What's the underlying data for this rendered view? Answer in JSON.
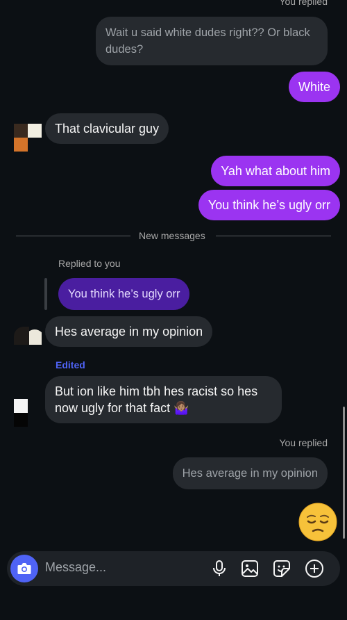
{
  "thread": {
    "top_reply_label": "You replied",
    "top_reply_text": "Wait u said white dudes right?? Or black dudes?",
    "msg_white": "White",
    "msg_clavicular": "That clavicular guy",
    "msg_yah": "Yah what about him",
    "msg_ugly": "You think he’s ugly orr",
    "divider_label": "New messages",
    "replied_to_you": "Replied to you",
    "quoted_text": "You think he’s ugly orr",
    "msg_average": "Hes average in my opinion",
    "edited_label": "Edited",
    "msg_racist_line1": "But ion like him tbh hes racist so hes",
    "msg_racist_line2": "now ugly for that fact 🤷🏽‍♀️",
    "bottom_reply_label": "You replied",
    "bottom_reply_text": "Hes average in my opinion",
    "emoji_reaction": "😩"
  },
  "composer": {
    "placeholder": "Message...",
    "camera_icon": "camera-icon",
    "mic_icon": "microphone-icon",
    "gallery_icon": "gallery-icon",
    "sticker_icon": "sticker-icon",
    "add_icon": "plus-circle-icon"
  },
  "colors": {
    "background": "#0c1014",
    "incoming_bubble": "#262a2f",
    "outgoing_bubble": "#9b34f1",
    "quoted_bubble": "#4a1ea0",
    "edited_label": "#4f63f5",
    "camera_button": "#4f63f5"
  }
}
